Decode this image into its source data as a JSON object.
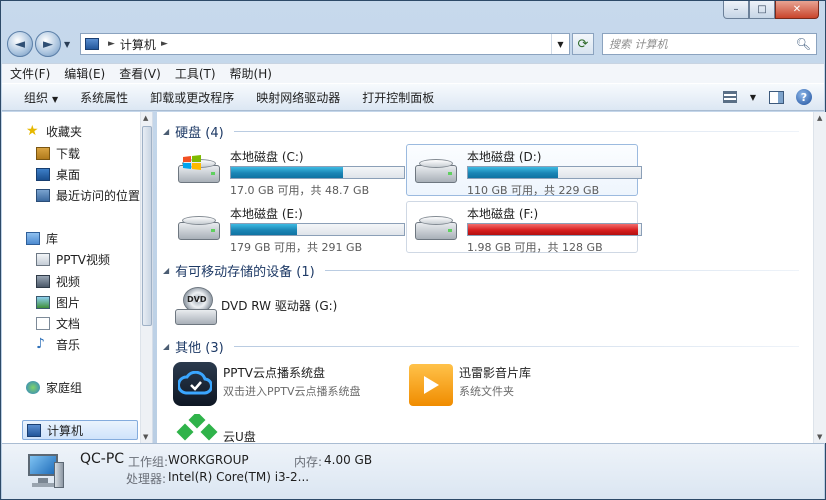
{
  "window": {
    "controls": {
      "minimize": "–",
      "maximize": "□",
      "close": "✕"
    }
  },
  "nav": {
    "back": "◄",
    "forward": "►",
    "address_path": [
      "计算机"
    ],
    "search_placeholder": "搜索 计算机"
  },
  "menubar": [
    "文件(F)",
    "编辑(E)",
    "查看(V)",
    "工具(T)",
    "帮助(H)"
  ],
  "toolbar": {
    "organize": "组织",
    "items": [
      "系统属性",
      "卸载或更改程序",
      "映射网络驱动器",
      "打开控制面板"
    ]
  },
  "sidebar": {
    "favorites": {
      "label": "收藏夹",
      "items": [
        "下载",
        "桌面",
        "最近访问的位置"
      ]
    },
    "libraries": {
      "label": "库",
      "items": [
        "PPTV视频",
        "视频",
        "图片",
        "文档",
        "音乐"
      ]
    },
    "homegroup": "家庭组",
    "computer": "计算机"
  },
  "groups": {
    "hard_disks": "硬盘 (4)",
    "removable": "有可移动存储的设备 (1)",
    "other": "其他 (3)"
  },
  "drives": [
    {
      "name": "本地磁盘 (C:)",
      "info": "17.0 GB 可用，共 48.7 GB",
      "used_fraction": 0.65,
      "full": false
    },
    {
      "name": "本地磁盘 (D:)",
      "info": "110 GB 可用，共 229 GB",
      "used_fraction": 0.52,
      "full": false
    },
    {
      "name": "本地磁盘 (E:)",
      "info": "179 GB 可用，共 291 GB",
      "used_fraction": 0.38,
      "full": false
    },
    {
      "name": "本地磁盘 (F:)",
      "info": "1.98 GB 可用，共 128 GB",
      "used_fraction": 0.985,
      "full": true
    }
  ],
  "removable": {
    "name": "DVD RW 驱动器 (G:)",
    "badge": "DVD"
  },
  "others": [
    {
      "name": "PPTV云点播系统盘",
      "sub": "双击进入PPTV云点播系统盘"
    },
    {
      "name": "迅雷影音片库",
      "sub": "系统文件夹"
    },
    {
      "name": "云U盘",
      "sub": ""
    }
  ],
  "details": {
    "pc_name": "QC-PC",
    "workgroup_label": "工作组:",
    "workgroup_value": "WORKGROUP",
    "memory_label": "内存:",
    "memory_value": "4.00 GB",
    "cpu_label": "处理器:",
    "cpu_value": "Intel(R) Core(TM) i3-2..."
  },
  "colors": {
    "bar_normal": "#1b85b5",
    "bar_full": "#d81f1f",
    "accent": "#1e3a66"
  }
}
